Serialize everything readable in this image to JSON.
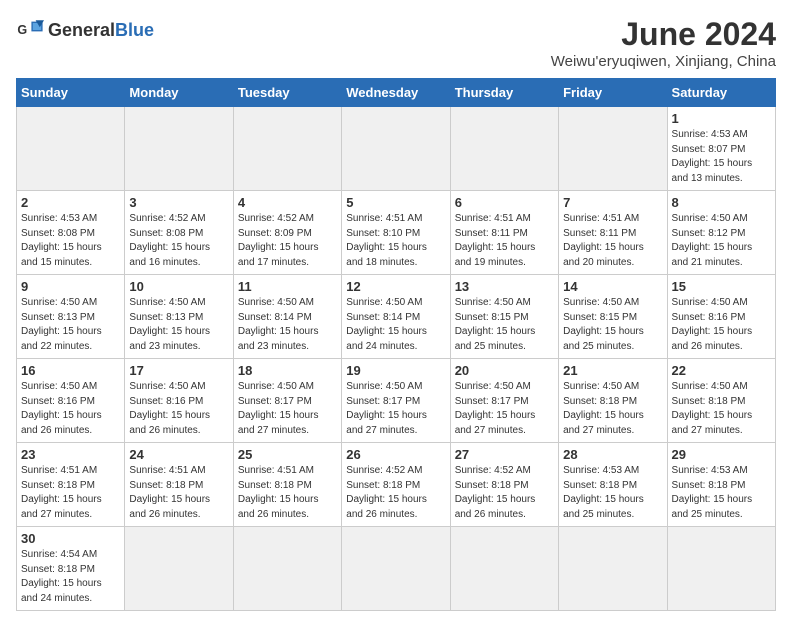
{
  "header": {
    "logo_text_normal": "General",
    "logo_text_bold": "Blue",
    "title": "June 2024",
    "subtitle": "Weiwu'eryuqiwen, Xinjiang, China"
  },
  "days_of_week": [
    "Sunday",
    "Monday",
    "Tuesday",
    "Wednesday",
    "Thursday",
    "Friday",
    "Saturday"
  ],
  "weeks": [
    [
      {
        "day": "",
        "info": ""
      },
      {
        "day": "",
        "info": ""
      },
      {
        "day": "",
        "info": ""
      },
      {
        "day": "",
        "info": ""
      },
      {
        "day": "",
        "info": ""
      },
      {
        "day": "",
        "info": ""
      },
      {
        "day": "1",
        "info": "Sunrise: 4:53 AM\nSunset: 8:07 PM\nDaylight: 15 hours\nand 13 minutes."
      }
    ],
    [
      {
        "day": "2",
        "info": "Sunrise: 4:53 AM\nSunset: 8:08 PM\nDaylight: 15 hours\nand 15 minutes."
      },
      {
        "day": "3",
        "info": "Sunrise: 4:52 AM\nSunset: 8:08 PM\nDaylight: 15 hours\nand 16 minutes."
      },
      {
        "day": "4",
        "info": "Sunrise: 4:52 AM\nSunset: 8:09 PM\nDaylight: 15 hours\nand 17 minutes."
      },
      {
        "day": "5",
        "info": "Sunrise: 4:51 AM\nSunset: 8:10 PM\nDaylight: 15 hours\nand 18 minutes."
      },
      {
        "day": "6",
        "info": "Sunrise: 4:51 AM\nSunset: 8:11 PM\nDaylight: 15 hours\nand 19 minutes."
      },
      {
        "day": "7",
        "info": "Sunrise: 4:51 AM\nSunset: 8:11 PM\nDaylight: 15 hours\nand 20 minutes."
      },
      {
        "day": "8",
        "info": "Sunrise: 4:50 AM\nSunset: 8:12 PM\nDaylight: 15 hours\nand 21 minutes."
      }
    ],
    [
      {
        "day": "9",
        "info": "Sunrise: 4:50 AM\nSunset: 8:13 PM\nDaylight: 15 hours\nand 22 minutes."
      },
      {
        "day": "10",
        "info": "Sunrise: 4:50 AM\nSunset: 8:13 PM\nDaylight: 15 hours\nand 23 minutes."
      },
      {
        "day": "11",
        "info": "Sunrise: 4:50 AM\nSunset: 8:14 PM\nDaylight: 15 hours\nand 23 minutes."
      },
      {
        "day": "12",
        "info": "Sunrise: 4:50 AM\nSunset: 8:14 PM\nDaylight: 15 hours\nand 24 minutes."
      },
      {
        "day": "13",
        "info": "Sunrise: 4:50 AM\nSunset: 8:15 PM\nDaylight: 15 hours\nand 25 minutes."
      },
      {
        "day": "14",
        "info": "Sunrise: 4:50 AM\nSunset: 8:15 PM\nDaylight: 15 hours\nand 25 minutes."
      },
      {
        "day": "15",
        "info": "Sunrise: 4:50 AM\nSunset: 8:16 PM\nDaylight: 15 hours\nand 26 minutes."
      }
    ],
    [
      {
        "day": "16",
        "info": "Sunrise: 4:50 AM\nSunset: 8:16 PM\nDaylight: 15 hours\nand 26 minutes."
      },
      {
        "day": "17",
        "info": "Sunrise: 4:50 AM\nSunset: 8:16 PM\nDaylight: 15 hours\nand 26 minutes."
      },
      {
        "day": "18",
        "info": "Sunrise: 4:50 AM\nSunset: 8:17 PM\nDaylight: 15 hours\nand 27 minutes."
      },
      {
        "day": "19",
        "info": "Sunrise: 4:50 AM\nSunset: 8:17 PM\nDaylight: 15 hours\nand 27 minutes."
      },
      {
        "day": "20",
        "info": "Sunrise: 4:50 AM\nSunset: 8:17 PM\nDaylight: 15 hours\nand 27 minutes."
      },
      {
        "day": "21",
        "info": "Sunrise: 4:50 AM\nSunset: 8:18 PM\nDaylight: 15 hours\nand 27 minutes."
      },
      {
        "day": "22",
        "info": "Sunrise: 4:50 AM\nSunset: 8:18 PM\nDaylight: 15 hours\nand 27 minutes."
      }
    ],
    [
      {
        "day": "23",
        "info": "Sunrise: 4:51 AM\nSunset: 8:18 PM\nDaylight: 15 hours\nand 27 minutes."
      },
      {
        "day": "24",
        "info": "Sunrise: 4:51 AM\nSunset: 8:18 PM\nDaylight: 15 hours\nand 26 minutes."
      },
      {
        "day": "25",
        "info": "Sunrise: 4:51 AM\nSunset: 8:18 PM\nDaylight: 15 hours\nand 26 minutes."
      },
      {
        "day": "26",
        "info": "Sunrise: 4:52 AM\nSunset: 8:18 PM\nDaylight: 15 hours\nand 26 minutes."
      },
      {
        "day": "27",
        "info": "Sunrise: 4:52 AM\nSunset: 8:18 PM\nDaylight: 15 hours\nand 26 minutes."
      },
      {
        "day": "28",
        "info": "Sunrise: 4:53 AM\nSunset: 8:18 PM\nDaylight: 15 hours\nand 25 minutes."
      },
      {
        "day": "29",
        "info": "Sunrise: 4:53 AM\nSunset: 8:18 PM\nDaylight: 15 hours\nand 25 minutes."
      }
    ],
    [
      {
        "day": "30",
        "info": "Sunrise: 4:54 AM\nSunset: 8:18 PM\nDaylight: 15 hours\nand 24 minutes."
      },
      {
        "day": "",
        "info": ""
      },
      {
        "day": "",
        "info": ""
      },
      {
        "day": "",
        "info": ""
      },
      {
        "day": "",
        "info": ""
      },
      {
        "day": "",
        "info": ""
      },
      {
        "day": "",
        "info": ""
      }
    ]
  ]
}
